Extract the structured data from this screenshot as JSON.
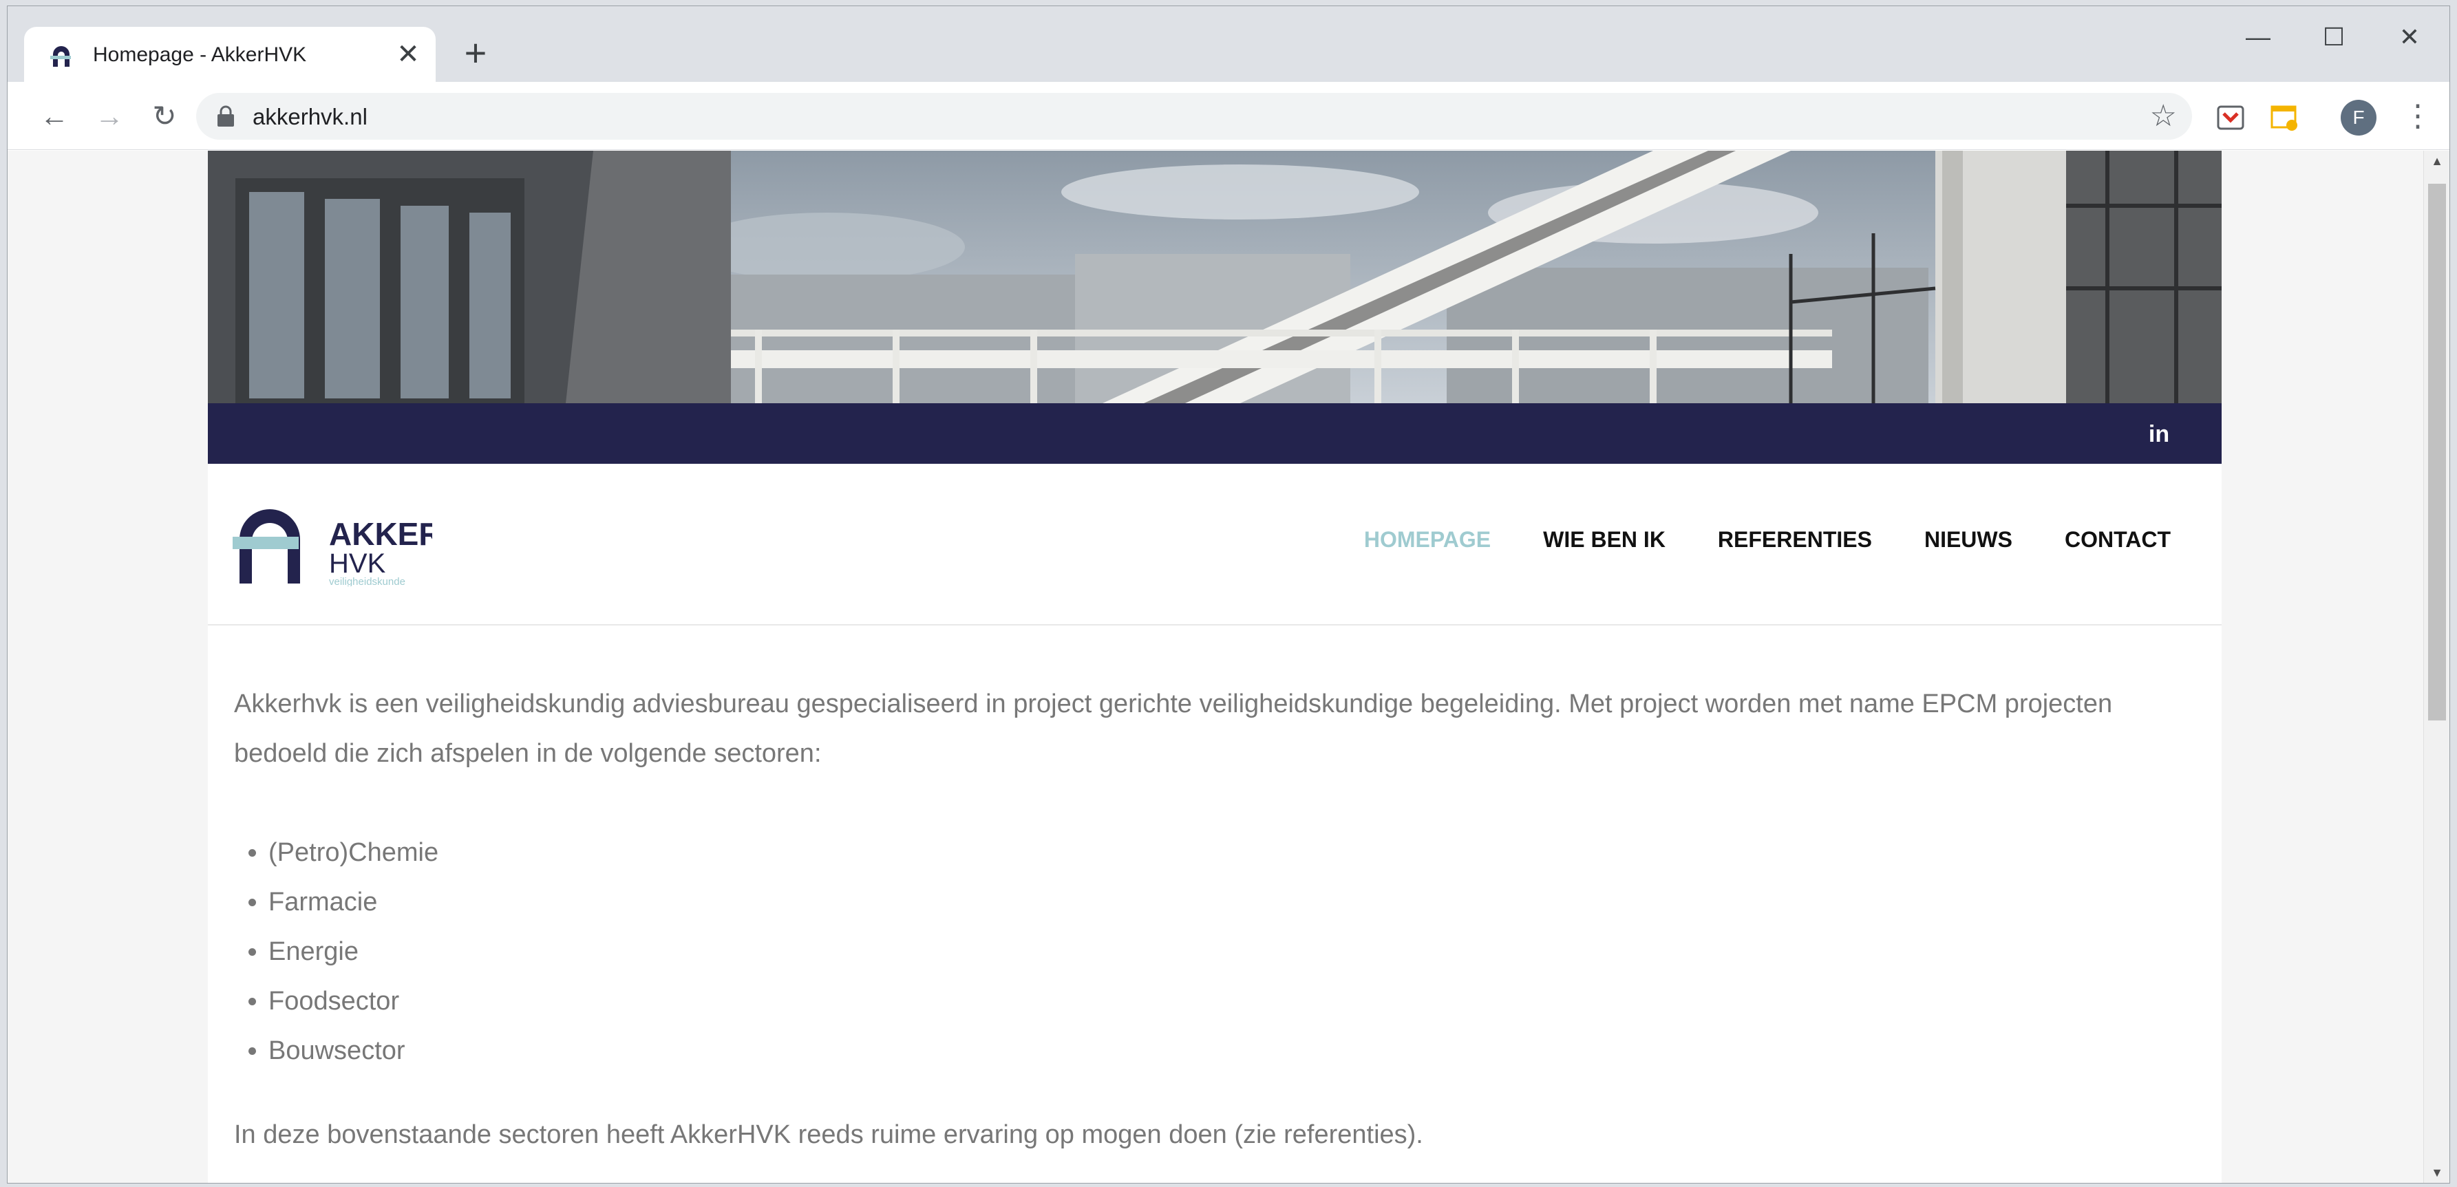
{
  "browser": {
    "tab_title": "Homepage - AkkerHVK",
    "url": "akkerhvk.nl",
    "profile_initial": "F",
    "new_tab_symbol": "+",
    "close_tab_symbol": "✕"
  },
  "site": {
    "logo": {
      "line1": "AKKER",
      "line2": "HVK",
      "tagline": "veiligheidskunde"
    },
    "nav": [
      {
        "label": "HOMEPAGE",
        "active": true
      },
      {
        "label": "WIE BEN IK",
        "active": false
      },
      {
        "label": "REFERENTIES",
        "active": false
      },
      {
        "label": "NIEUWS",
        "active": false
      },
      {
        "label": "CONTACT",
        "active": false
      }
    ],
    "social": {
      "linkedin_label": "in"
    },
    "colors": {
      "navy": "#23234d",
      "accent": "#9fcbd0",
      "text": "#777777"
    }
  },
  "content": {
    "intro": "Akkerhvk is een veiligheidskundig adviesbureau gespecialiseerd in project gerichte veiligheidskundige begeleiding. Met project worden met name EPCM projecten bedoeld die zich afspelen in de volgende sectoren:",
    "sectors": [
      "(Petro)Chemie",
      "Farmacie",
      "Energie",
      "Foodsector",
      "Bouwsector"
    ],
    "outro": "In deze bovenstaande sectoren heeft AkkerHVK reeds ruime ervaring op mogen doen (zie referenties)."
  }
}
